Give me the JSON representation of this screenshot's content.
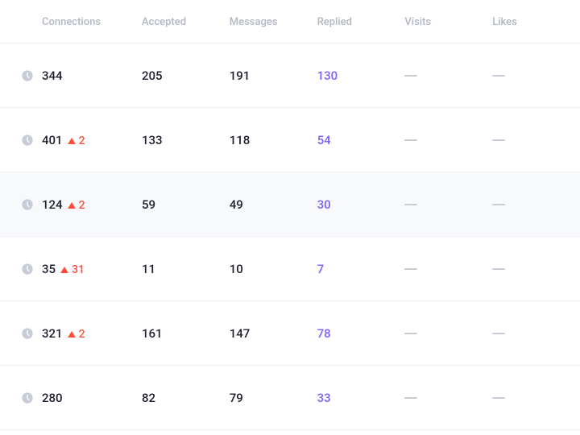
{
  "columns": {
    "connections": "Connections",
    "accepted": "Accepted",
    "messages": "Messages",
    "replied": "Replied",
    "visits": "Visits",
    "likes": "Likes"
  },
  "empty": "—",
  "rows": [
    {
      "connections": "344",
      "warn": null,
      "accepted": "205",
      "messages": "191",
      "replied": "130"
    },
    {
      "connections": "401",
      "warn": "2",
      "accepted": "133",
      "messages": "118",
      "replied": "54"
    },
    {
      "connections": "124",
      "warn": "2",
      "accepted": "59",
      "messages": "49",
      "replied": "30",
      "hovered": true
    },
    {
      "connections": "35",
      "warn": "31",
      "accepted": "11",
      "messages": "10",
      "replied": "7"
    },
    {
      "connections": "321",
      "warn": "2",
      "accepted": "161",
      "messages": "147",
      "replied": "78"
    },
    {
      "connections": "280",
      "warn": null,
      "accepted": "82",
      "messages": "79",
      "replied": "33"
    }
  ]
}
